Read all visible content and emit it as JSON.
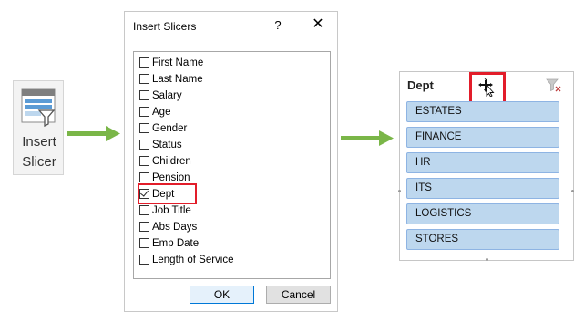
{
  "ribbon_button": {
    "label_line1": "Insert",
    "label_line2": "Slicer",
    "icon": "slicer-funnel-icon"
  },
  "dialog": {
    "title": "Insert Slicers",
    "help_label": "?",
    "close_label": "✕",
    "fields": [
      {
        "label": "First Name",
        "checked": false
      },
      {
        "label": "Last Name",
        "checked": false
      },
      {
        "label": "Salary",
        "checked": false
      },
      {
        "label": "Age",
        "checked": false
      },
      {
        "label": "Gender",
        "checked": false
      },
      {
        "label": "Status",
        "checked": false
      },
      {
        "label": "Children",
        "checked": false
      },
      {
        "label": "Pension",
        "checked": false
      },
      {
        "label": "Dept",
        "checked": true
      },
      {
        "label": "Job Title",
        "checked": false
      },
      {
        "label": "Abs Days",
        "checked": false
      },
      {
        "label": "Emp Date",
        "checked": false
      },
      {
        "label": "Length of Service",
        "checked": false
      }
    ],
    "ok_label": "OK",
    "cancel_label": "Cancel"
  },
  "slicer": {
    "title": "Dept",
    "items": [
      "ESTATES",
      "FINANCE",
      "HR",
      "ITS",
      "LOGISTICS",
      "STORES"
    ],
    "move_icon": "move-cursor-icon",
    "clear_filter_icon": "clear-filter-icon"
  },
  "colors": {
    "arrow_green": "#7ab648",
    "highlight_red": "#e21d2a",
    "slicer_item_fill": "#bdd7ee",
    "slicer_item_border": "#8eb4e3"
  }
}
